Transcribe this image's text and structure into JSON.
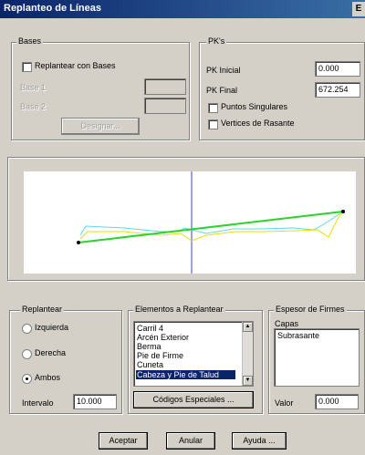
{
  "window": {
    "title": "Replanteo de Líneas",
    "close_glyph": "E"
  },
  "bases": {
    "group_label": "Bases",
    "checkbox_label": "Replantear con Bases",
    "base1_label": "Base 1",
    "base2_label": "Base 2",
    "base1_value": "",
    "base2_value": "",
    "designate_button": "Designar..."
  },
  "pks": {
    "group_label": "PK's",
    "pk_initial_label": "PK Inicial",
    "pk_initial_value": "0.000",
    "pk_final_label": "PK Final",
    "pk_final_value": "672.254",
    "singular_points_label": "Puntos Singulares",
    "vertices_label": "Vertices de Rasante"
  },
  "replantear": {
    "group_label": "Replantear",
    "options": [
      "Izquierda",
      "Derecha",
      "Ambos"
    ],
    "selected": "Ambos",
    "interval_label": "Intervalo",
    "interval_value": "10.000"
  },
  "elementos": {
    "group_label": "Elementos a Replantear",
    "items": [
      "Carril 4",
      "Arcén Exterior",
      "Berma",
      "Pie de Firme",
      "Cuneta",
      "Cabeza y Pie de Talud"
    ],
    "selected": "Cabeza y Pie de Talud",
    "special_codes_button": "Códigos Especiales ..."
  },
  "espesor": {
    "group_label": "Espesor de Firmes",
    "layers_label": "Capas",
    "layers": [
      "Subrasante"
    ],
    "value_label": "Valor",
    "value": "0.000"
  },
  "footer": {
    "ok": "Aceptar",
    "cancel": "Anular",
    "help": "Ayuda ..."
  },
  "colors": {
    "title_bg": "#0a246a",
    "line_green": "#2bd32b",
    "line_cyan": "#5fd7f0",
    "line_yellow": "#e8e000",
    "axis_blue": "#3b3bff"
  }
}
